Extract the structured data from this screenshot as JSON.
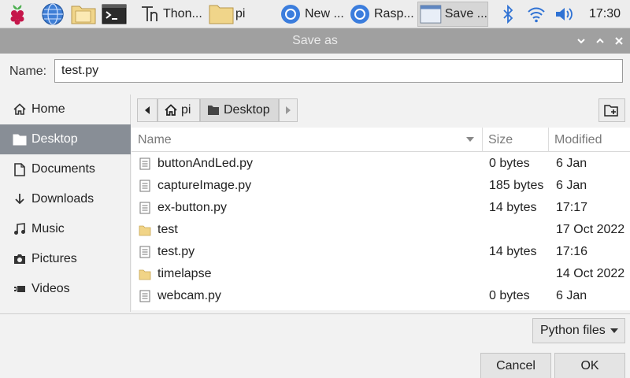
{
  "taskbar": {
    "items": [
      {
        "icon": "raspberry-menu-icon",
        "label": ""
      },
      {
        "icon": "web-browser-globe-icon",
        "label": ""
      },
      {
        "icon": "file-manager-folder-icon",
        "label": ""
      },
      {
        "icon": "terminal-icon",
        "label": ""
      },
      {
        "icon": "thonny-icon",
        "label": "Thon..."
      },
      {
        "icon": "folder-icon",
        "label": "pi"
      },
      {
        "icon": "chromium-icon",
        "label": "New ..."
      },
      {
        "icon": "chromium-icon",
        "label": "Rasp..."
      },
      {
        "icon": "window-icon",
        "label": "Save ..."
      }
    ],
    "tray": [
      "bluetooth-icon",
      "wifi-icon",
      "volume-icon"
    ],
    "clock": "17:30"
  },
  "dialog": {
    "title": "Save as",
    "name_label": "Name:",
    "name_value": "test.py",
    "sidebar": [
      {
        "icon": "home-icon",
        "label": "Home",
        "selected": false
      },
      {
        "icon": "folder-icon",
        "label": "Desktop",
        "selected": true
      },
      {
        "icon": "document-icon",
        "label": "Documents",
        "selected": false
      },
      {
        "icon": "download-icon",
        "label": "Downloads",
        "selected": false
      },
      {
        "icon": "music-icon",
        "label": "Music",
        "selected": false
      },
      {
        "icon": "camera-icon",
        "label": "Pictures",
        "selected": false
      },
      {
        "icon": "video-icon",
        "label": "Videos",
        "selected": false
      }
    ],
    "path": [
      {
        "icon": "home-icon",
        "label": "pi"
      },
      {
        "icon": "folder-icon",
        "label": "Desktop"
      }
    ],
    "columns": {
      "name": "Name",
      "size": "Size",
      "modified": "Modified"
    },
    "files": [
      {
        "type": "file",
        "name": "buttonAndLed.py",
        "size": "0 bytes",
        "modified": "6 Jan"
      },
      {
        "type": "file",
        "name": "captureImage.py",
        "size": "185 bytes",
        "modified": "6 Jan"
      },
      {
        "type": "file",
        "name": "ex-button.py",
        "size": "14 bytes",
        "modified": "17:17"
      },
      {
        "type": "folder",
        "name": "test",
        "size": "",
        "modified": "17 Oct 2022"
      },
      {
        "type": "file",
        "name": "test.py",
        "size": "14 bytes",
        "modified": "17:16"
      },
      {
        "type": "folder",
        "name": "timelapse",
        "size": "",
        "modified": "14 Oct 2022"
      },
      {
        "type": "file",
        "name": "webcam.py",
        "size": "0 bytes",
        "modified": "6 Jan"
      }
    ],
    "filter": "Python files",
    "cancel_label": "Cancel",
    "ok_label": "OK"
  }
}
